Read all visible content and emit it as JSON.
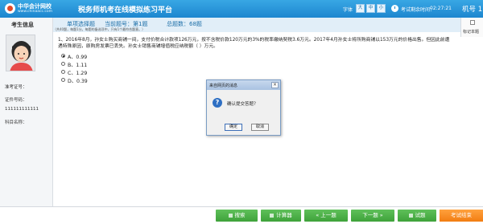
{
  "header": {
    "logo_name": "中华会计网校",
    "logo_url": "www.chinaacc.com",
    "title": "税务师机考在线模拟练习平台",
    "font_label": "字体",
    "font_sizes": [
      "大",
      "中",
      "小"
    ],
    "time_label": "考试剩余时间：",
    "time_value": "02:27:21",
    "machine": "机号 1"
  },
  "sidebar": {
    "title": "考生信息",
    "admission_label": "准考证号：",
    "id_label": "证件号码：",
    "id_value": "111111111111",
    "subject_label": "科目名称："
  },
  "question_header": {
    "type": "单项选择题",
    "current": "当前题号：第1题",
    "total": "总题数：68题",
    "note": "（共40题，每题1分。每题的备选项中，只有1个最符合题意。）",
    "mark_label": "标记本题"
  },
  "question": {
    "text": "1、2016年8月，孙女士购买商铺一间，支付价税合计款项126万元，按不含税价款120万元的3%的税率缴纳契税3.6万元。2017年4月孙女士将所购商铺以153万元的价格出售。但因此前遭遇特殊原因，原购房发票已丢失。孙女士销售商铺增值税应纳税额（     ）万元。",
    "options": [
      {
        "label": "A、0.99",
        "selected": true
      },
      {
        "label": "B、1.11",
        "selected": false
      },
      {
        "label": "C、1.29",
        "selected": false
      },
      {
        "label": "D、0.39",
        "selected": false
      }
    ]
  },
  "dialog": {
    "title": "来自网页的消息",
    "close": "×",
    "icon": "?",
    "message": "确认提交答题？",
    "ok": "确定",
    "cancel": "取消"
  },
  "footer": {
    "buttons": [
      "搜索",
      "计算器",
      "« 上一题",
      "下一题 »",
      "试题",
      "考试结束"
    ]
  },
  "colors": {
    "header": "#1d86cf",
    "button_green": "#3ea23a",
    "button_orange": "#f27d12"
  }
}
